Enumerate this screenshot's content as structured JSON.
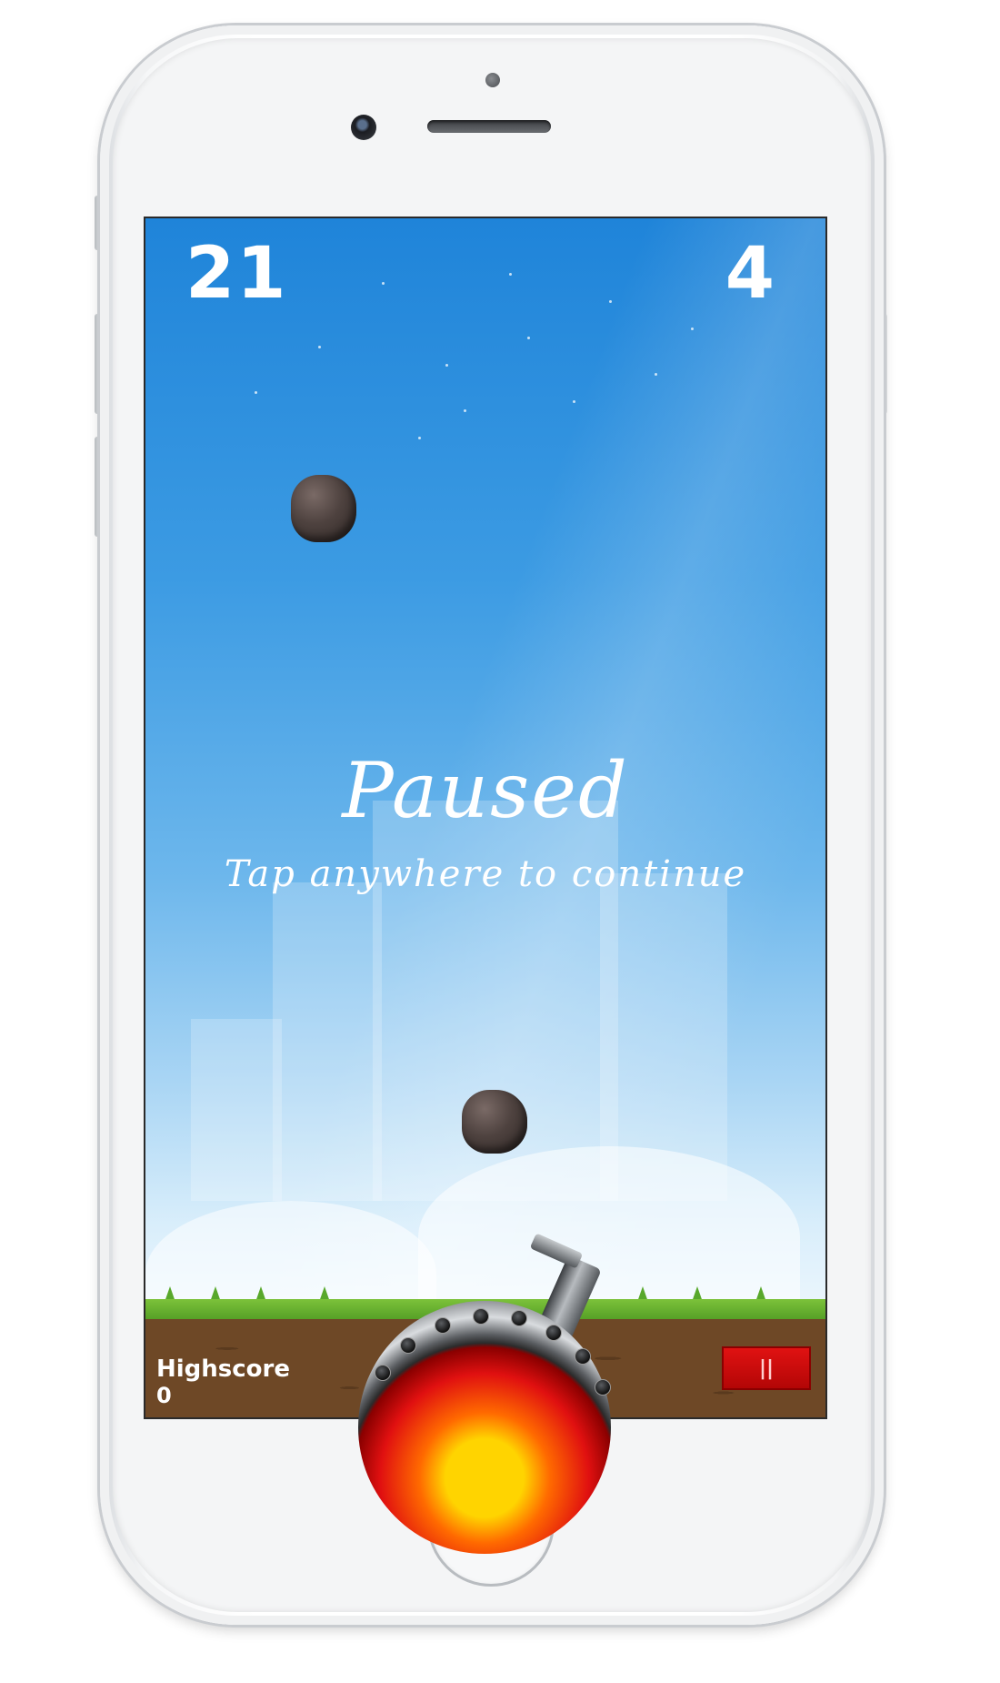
{
  "hud": {
    "score": "21",
    "lives": "4"
  },
  "overlay": {
    "title": "Paused",
    "subtitle": "Tap anywhere to continue"
  },
  "footer": {
    "highscore_label": "Highscore",
    "highscore_value": "0",
    "pause_button_label": "||"
  },
  "colors": {
    "sky_top": "#1f84d9",
    "sky_bottom": "#eef7fd",
    "pause_button": "#e01212",
    "grass": "#58a82b",
    "ground": "#6e4826"
  },
  "icons": {
    "pause": "pause-icon"
  }
}
